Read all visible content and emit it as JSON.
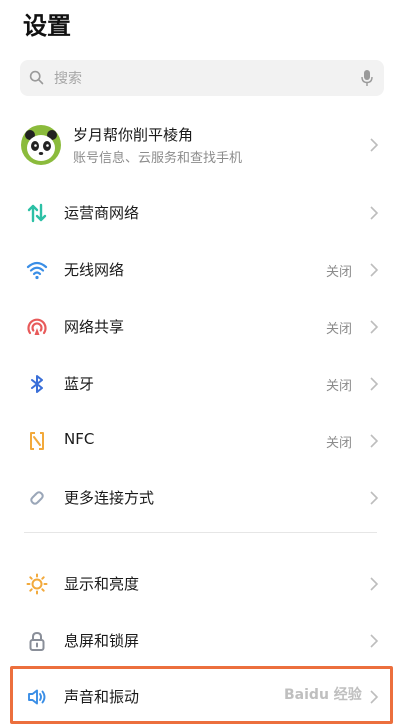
{
  "page": {
    "title": "设置"
  },
  "search": {
    "placeholder": "搜索",
    "value": ""
  },
  "profile": {
    "name": "岁月帮你削平棱角",
    "subtitle": "账号信息、云服务和查找手机"
  },
  "section1": [
    {
      "label": "运营商网络",
      "value": "",
      "icon": "cellular-data-icon"
    },
    {
      "label": "无线网络",
      "value": "关闭",
      "icon": "wifi-icon"
    },
    {
      "label": "网络共享",
      "value": "关闭",
      "icon": "hotspot-icon"
    },
    {
      "label": "蓝牙",
      "value": "关闭",
      "icon": "bluetooth-icon"
    },
    {
      "label": "NFC",
      "value": "关闭",
      "icon": "nfc-icon"
    },
    {
      "label": "更多连接方式",
      "value": "",
      "icon": "link-icon"
    }
  ],
  "section2": [
    {
      "label": "显示和亮度",
      "value": "",
      "icon": "brightness-icon"
    },
    {
      "label": "息屏和锁屏",
      "value": "",
      "icon": "lock-icon"
    },
    {
      "label": "声音和振动",
      "value": "",
      "icon": "speaker-icon"
    }
  ],
  "watermark": {
    "text": "Baidu 经验"
  },
  "colors": {
    "highlight": "#ec6f3d",
    "cellular": "#2cc0a5",
    "wifi": "#3a8ee6",
    "hotspot": "#e85a5a",
    "bluetooth": "#3a6fd8",
    "nfc": "#f2a93b",
    "link": "#9aa6b8",
    "brightness": "#f2a93b",
    "lock": "#8a8f99",
    "speaker": "#3a8ee6"
  }
}
